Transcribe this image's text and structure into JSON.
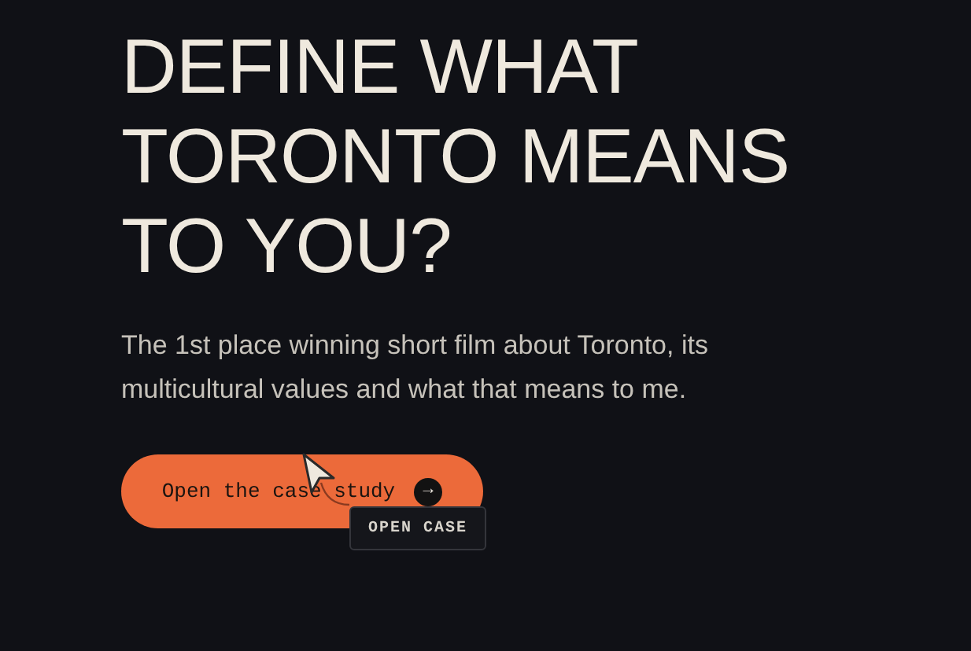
{
  "heading": "DEFINE WHAT TORONTO MEANS TO YOU?",
  "description": "The 1st place winning short film about Toronto, its multicultural values and what that means to me.",
  "cta": {
    "label": "Open the case study",
    "arrow": "→"
  },
  "cursor_tooltip": "OPEN CASE"
}
